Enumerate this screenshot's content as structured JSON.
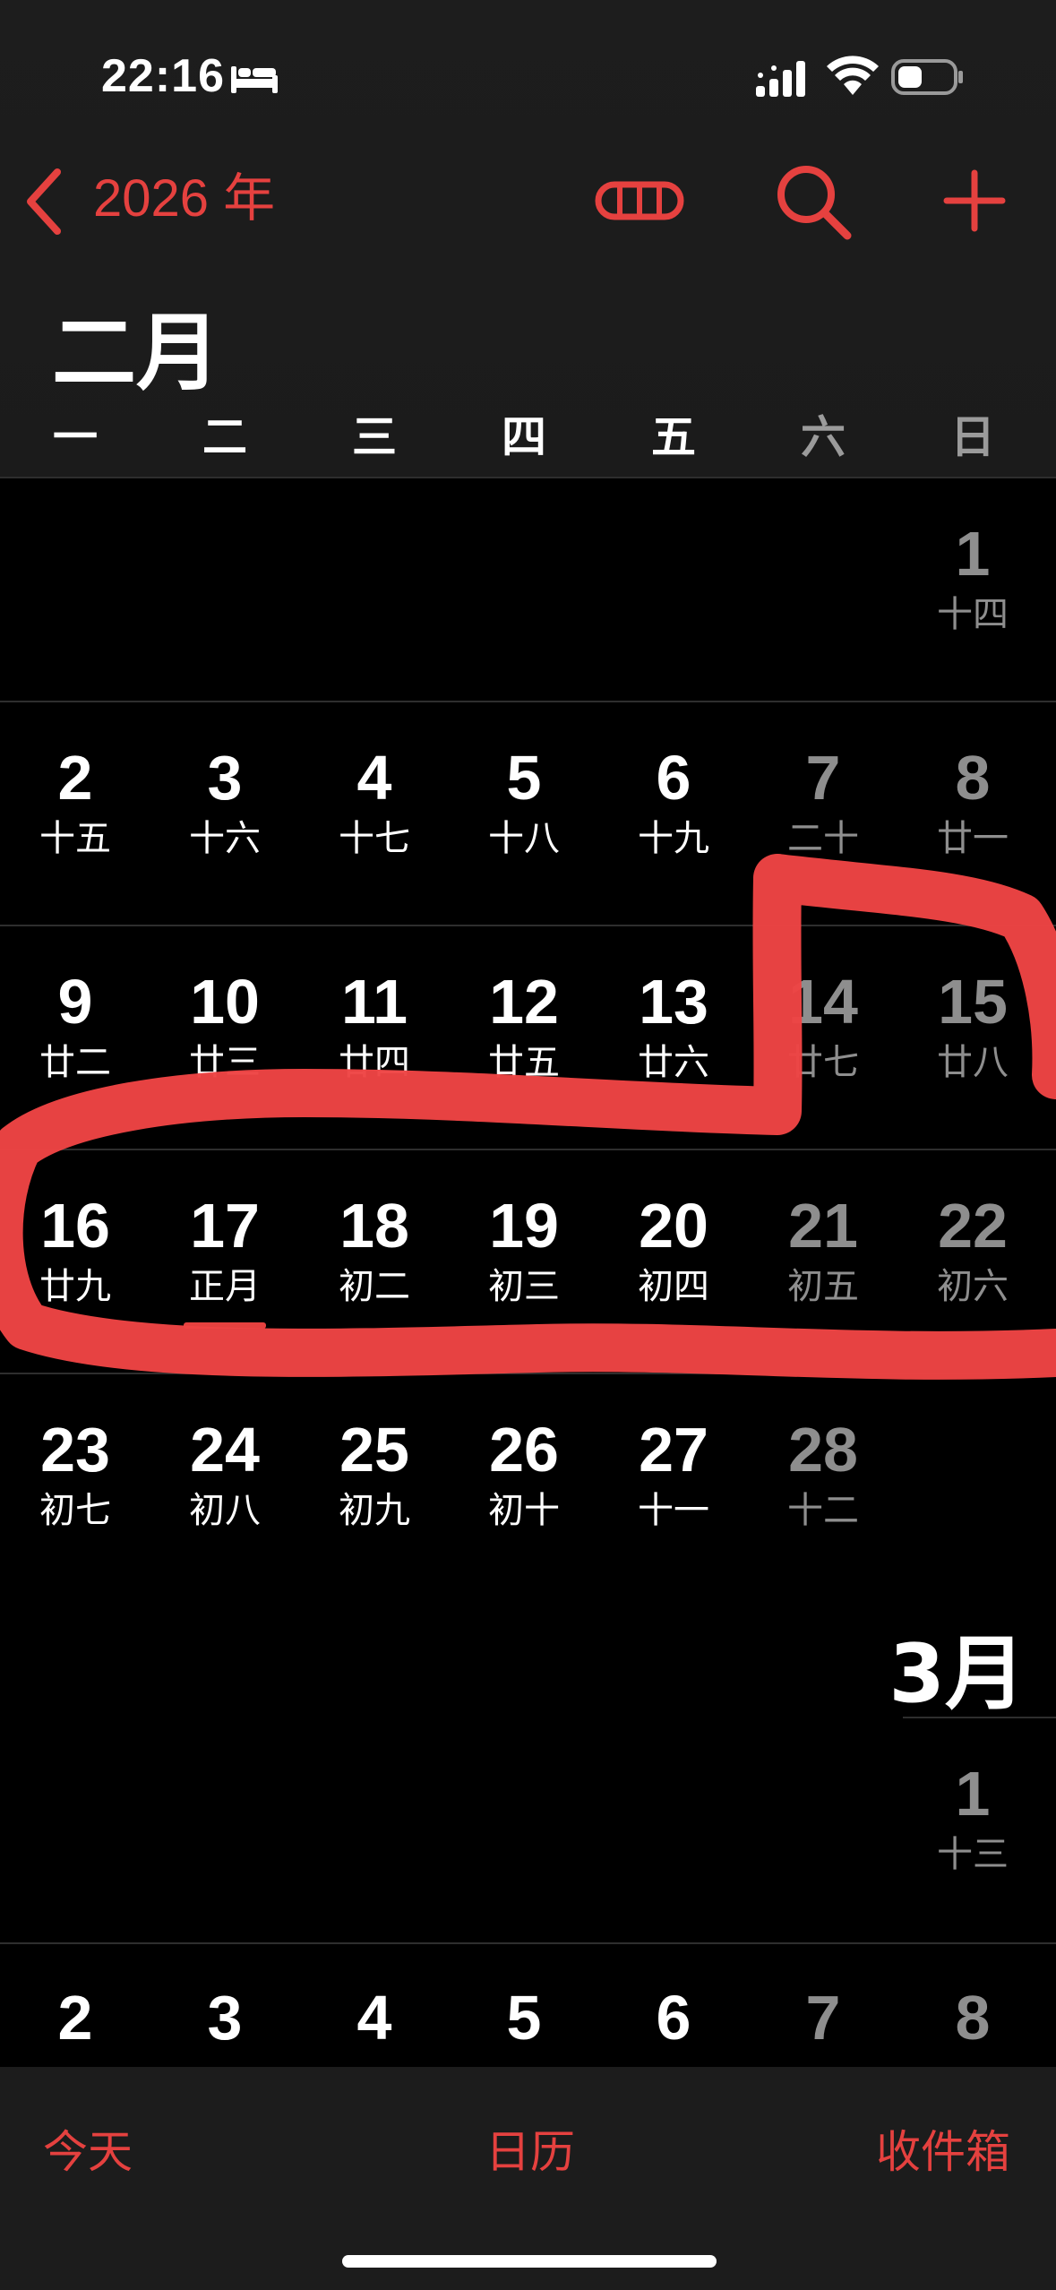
{
  "status_bar": {
    "time": "22:16",
    "icons": [
      "bed-icon",
      "signal-icon",
      "wifi-icon",
      "battery-icon"
    ]
  },
  "nav": {
    "back_label": "2026 年",
    "icons": [
      "chevron-left-icon",
      "view-toggle-icon",
      "search-icon",
      "add-icon"
    ]
  },
  "colors": {
    "accent": "#e5413f",
    "background": "#000000",
    "header_background": "#1c1c1c",
    "weekend_text": "#8e8e8e",
    "annotation": "#ee4444"
  },
  "month_title": "二月",
  "weekdays": [
    "一",
    "二",
    "三",
    "四",
    "五",
    "六",
    "日"
  ],
  "february_weeks": [
    [
      null,
      null,
      null,
      null,
      null,
      null,
      {
        "n": "1",
        "l": "十四"
      }
    ],
    [
      {
        "n": "2",
        "l": "十五"
      },
      {
        "n": "3",
        "l": "十六"
      },
      {
        "n": "4",
        "l": "十七"
      },
      {
        "n": "5",
        "l": "十八"
      },
      {
        "n": "6",
        "l": "十九"
      },
      {
        "n": "7",
        "l": "二十"
      },
      {
        "n": "8",
        "l": "廿一"
      }
    ],
    [
      {
        "n": "9",
        "l": "廿二"
      },
      {
        "n": "10",
        "l": "廿三"
      },
      {
        "n": "11",
        "l": "廿四"
      },
      {
        "n": "12",
        "l": "廿五"
      },
      {
        "n": "13",
        "l": "廿六"
      },
      {
        "n": "14",
        "l": "廿七"
      },
      {
        "n": "15",
        "l": "廿八"
      }
    ],
    [
      {
        "n": "16",
        "l": "廿九"
      },
      {
        "n": "17",
        "l": "正月",
        "today": true
      },
      {
        "n": "18",
        "l": "初二"
      },
      {
        "n": "19",
        "l": "初三"
      },
      {
        "n": "20",
        "l": "初四"
      },
      {
        "n": "21",
        "l": "初五"
      },
      {
        "n": "22",
        "l": "初六"
      }
    ],
    [
      {
        "n": "23",
        "l": "初七"
      },
      {
        "n": "24",
        "l": "初八"
      },
      {
        "n": "25",
        "l": "初九"
      },
      {
        "n": "26",
        "l": "初十"
      },
      {
        "n": "27",
        "l": "十一"
      },
      {
        "n": "28",
        "l": "十二"
      },
      null
    ]
  ],
  "march_title": "3月",
  "march_weeks": [
    [
      null,
      null,
      null,
      null,
      null,
      null,
      {
        "n": "1",
        "l": "十三"
      }
    ],
    [
      {
        "n": "2",
        "l": ""
      },
      {
        "n": "3",
        "l": ""
      },
      {
        "n": "4",
        "l": ""
      },
      {
        "n": "5",
        "l": ""
      },
      {
        "n": "6",
        "l": ""
      },
      {
        "n": "7",
        "l": ""
      },
      {
        "n": "8",
        "l": ""
      }
    ]
  ],
  "tabbar": {
    "today": "今天",
    "calendars": "日历",
    "inbox": "收件箱"
  }
}
